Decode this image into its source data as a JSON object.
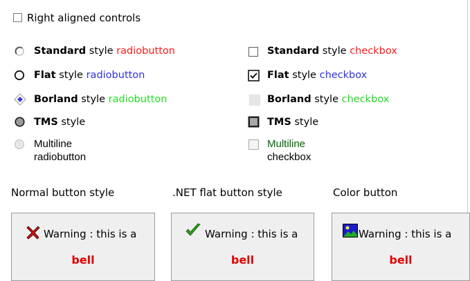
{
  "right_aligned": {
    "label": "Right aligned controls",
    "checked": false
  },
  "radios": [
    {
      "bold": "Standard",
      "mid": " style ",
      "colored": "radiobutton",
      "color": "#ff1a1a",
      "style": "standard",
      "checked": false
    },
    {
      "bold": "Flat",
      "mid": " style ",
      "colored": "radiobutton",
      "color": "#3030e0",
      "style": "flat",
      "checked": false
    },
    {
      "bold": "Borland",
      "mid": " style ",
      "colored": "radiobutton",
      "color": "#22dd22",
      "style": "borland",
      "checked": true
    },
    {
      "bold": "TMS",
      "mid": " style",
      "colored": "",
      "style": "tms",
      "checked": false
    },
    {
      "line1": "Multiline",
      "line2": "radiobutton",
      "style": "multiline",
      "checked": false
    }
  ],
  "checkboxes": [
    {
      "bold": "Standard",
      "mid": " style ",
      "colored": "checkbox",
      "color": "#ff1a1a",
      "style": "standard",
      "checked": false
    },
    {
      "bold": "Flat",
      "mid": " style ",
      "colored": "checkbox",
      "color": "#3030e0",
      "style": "flat",
      "checked": true
    },
    {
      "bold": "Borland",
      "mid": " style ",
      "colored": "checkbox",
      "color": "#22dd22",
      "style": "borland",
      "checked": false
    },
    {
      "bold": "TMS",
      "mid": " style",
      "colored": "",
      "style": "tms",
      "checked": false
    },
    {
      "line1": "Multiline",
      "line2": "checkbox",
      "color": "#006400",
      "style": "multiline",
      "checked": false
    }
  ],
  "button_captions": {
    "normal": "Normal button style",
    "netflat": ".NET flat button style",
    "color": "Color button"
  },
  "buttons": [
    {
      "text": "Warning : this is a",
      "bell": "bell",
      "icon": "red-x-icon"
    },
    {
      "text": "Warning : this is a",
      "bell": "bell",
      "icon": "green-check-icon"
    },
    {
      "text": "Warning : this is a",
      "bell": "bell",
      "icon": "picture-icon"
    }
  ],
  "colors": {
    "bell": "#e00000",
    "button_bg": "#efefef"
  }
}
